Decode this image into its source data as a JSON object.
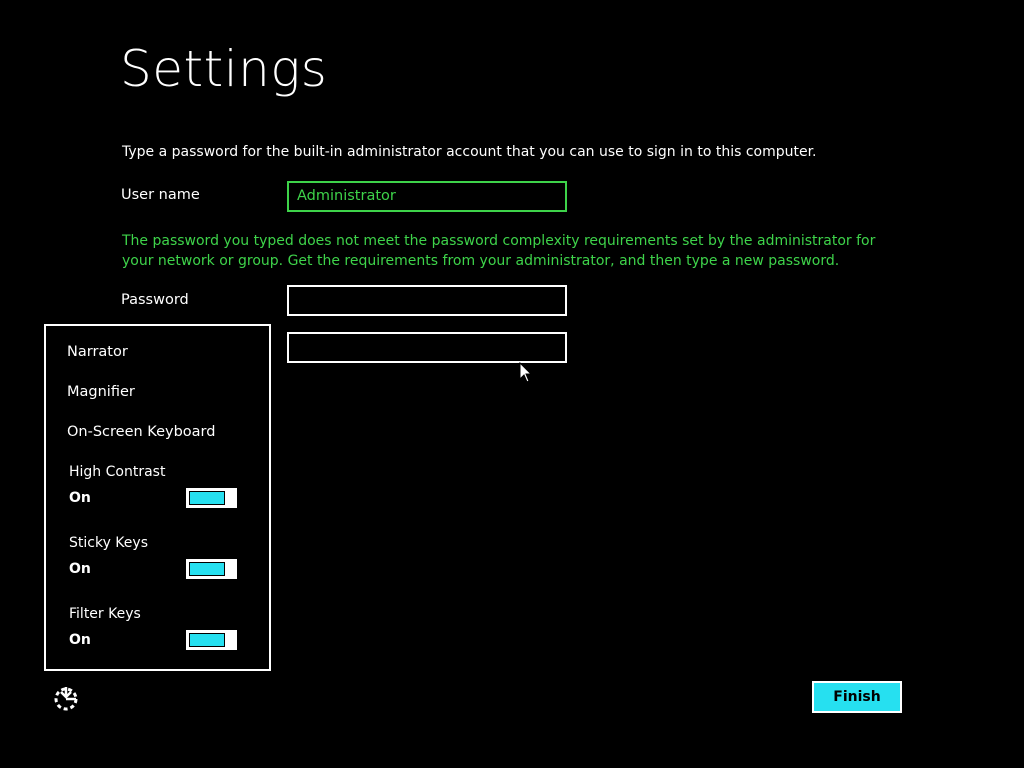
{
  "page": {
    "title": "Settings",
    "instruction": "Type a password for the built-in administrator account that you can use to sign in to this computer."
  },
  "form": {
    "username_label": "User name",
    "username_value": "Administrator",
    "error_message": "The password you typed does not meet the password complexity requirements set by the administrator for your network or group. Get the requirements from your administrator, and then type a new password.",
    "password_label": "Password",
    "password_value": "",
    "reenter_password_value": ""
  },
  "ease_of_access": {
    "narrator": "Narrator",
    "magnifier": "Magnifier",
    "on_screen_keyboard": "On-Screen Keyboard",
    "toggles": [
      {
        "label": "High Contrast",
        "state": "On",
        "enabled": true
      },
      {
        "label": "Sticky Keys",
        "state": "On",
        "enabled": true
      },
      {
        "label": "Filter Keys",
        "state": "On",
        "enabled": true
      }
    ],
    "icon": "ease-of-access-icon"
  },
  "footer": {
    "finish_label": "Finish"
  },
  "colors": {
    "background": "#000000",
    "accent_green": "#3ed34a",
    "accent_cyan": "#26e0f0",
    "text": "#ffffff"
  }
}
